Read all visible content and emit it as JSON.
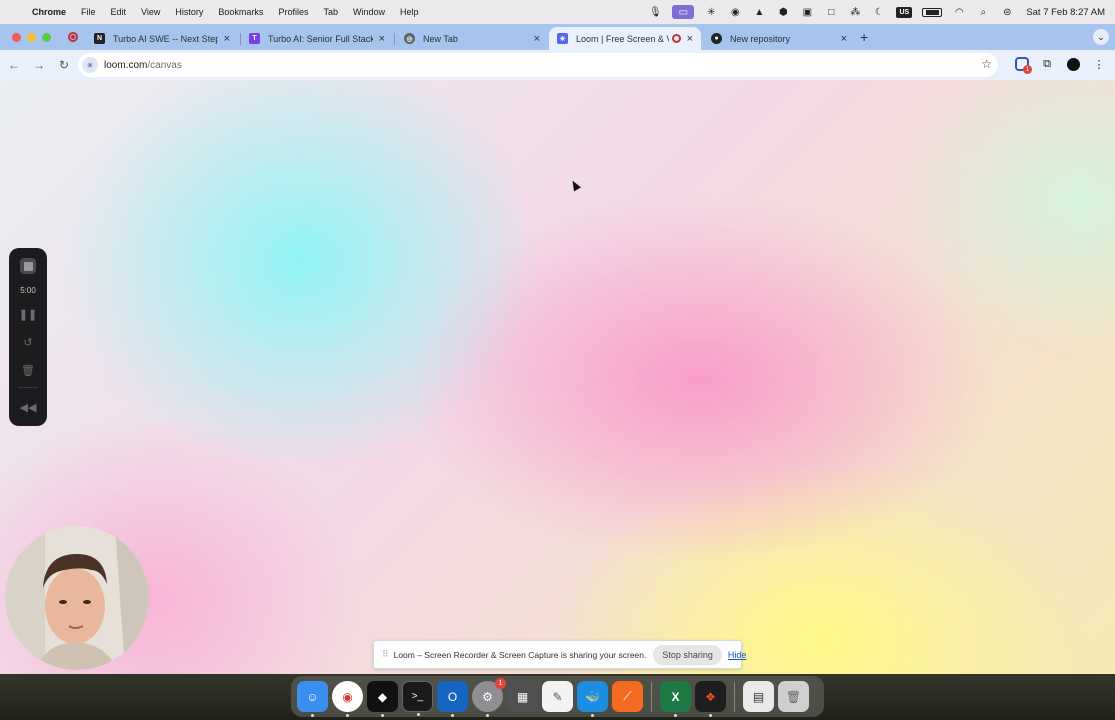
{
  "menubar": {
    "app_name": "Chrome",
    "items": [
      "File",
      "Edit",
      "View",
      "History",
      "Bookmarks",
      "Profiles",
      "Tab",
      "Window",
      "Help"
    ],
    "input_source": "US",
    "datetime": "Sat 7 Feb  8:27 AM"
  },
  "tabs": [
    {
      "title": "Turbo AI SWE -- Next Steps",
      "favicon": "notion-icon"
    },
    {
      "title": "Turbo AI: Senior Full Stack En",
      "favicon": "turbo-ai-icon"
    },
    {
      "title": "New Tab",
      "favicon": "chrome-icon"
    },
    {
      "title": "Loom | Free Screen & Vid",
      "favicon": "loom-icon",
      "active": true,
      "recording": true
    },
    {
      "title": "New repository",
      "favicon": "github-icon"
    }
  ],
  "address_bar": {
    "host": "loom.com",
    "path": "/canvas"
  },
  "extension_badge": "1",
  "loom_controls": {
    "timer": "5:00"
  },
  "share_bar": {
    "grip": "⠿",
    "message": "Loom – Screen Recorder & Screen Capture is sharing your screen.",
    "stop_label": "Stop sharing",
    "hide_label": "Hide"
  },
  "dock": {
    "apps": [
      {
        "name": "finder-icon",
        "color": "#3b8ef0"
      },
      {
        "name": "chrome-icon",
        "color": "#ffffff"
      },
      {
        "name": "cursor-app-icon",
        "color": "#111111"
      },
      {
        "name": "terminal-icon",
        "color": "#1a1a1a"
      },
      {
        "name": "outlook-icon",
        "color": "#1665c0"
      },
      {
        "name": "system-settings-icon",
        "color": "#8e8e93",
        "badge": "1"
      },
      {
        "name": "calculator-icon",
        "color": "#505050"
      },
      {
        "name": "textedit-icon",
        "color": "#f2f2f2"
      },
      {
        "name": "docker-icon",
        "color": "#1d8de0"
      },
      {
        "name": "paw-app-icon",
        "color": "#f26b21"
      },
      {
        "name": "excel-icon",
        "color": "#1e7a45"
      },
      {
        "name": "figma-icon",
        "color": "#1e1e1e"
      },
      {
        "name": "preview-icon",
        "color": "#e9e9e9"
      },
      {
        "name": "trash-icon",
        "color": "#cfcfcf"
      }
    ]
  }
}
